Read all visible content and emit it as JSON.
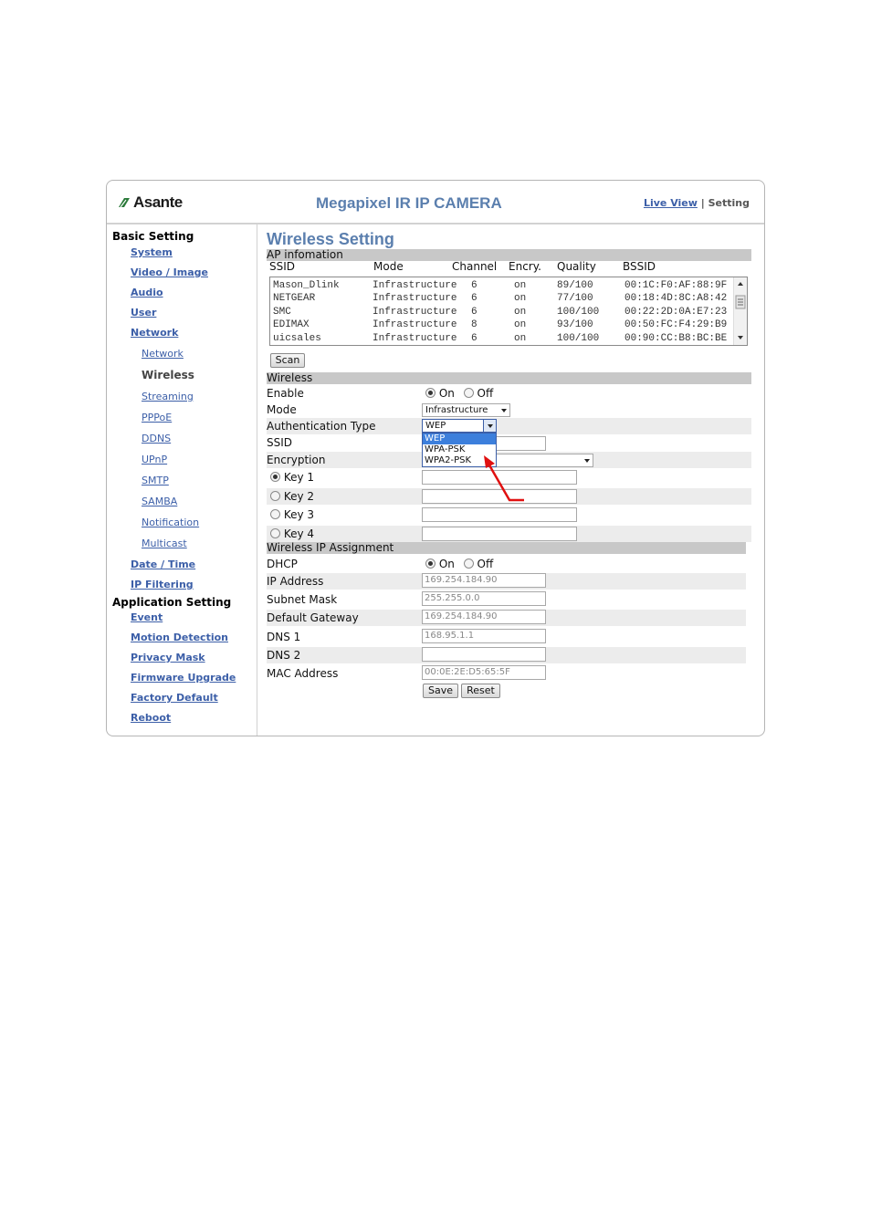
{
  "header": {
    "brand": "Asante",
    "product": "Megapixel IR IP CAMERA",
    "nav_live": "Live View",
    "nav_sep": "|",
    "nav_setting": "Setting"
  },
  "sidebar": {
    "basic_heading": "Basic Setting",
    "app_heading": "Application Setting",
    "basic_items": [
      "System",
      "Video / Image",
      "Audio",
      "User",
      "Network"
    ],
    "network_items": [
      "Network",
      "Wireless",
      "Streaming",
      "PPPoE",
      "DDNS",
      "UPnP",
      "SMTP",
      "SAMBA",
      "Notification",
      "Multicast"
    ],
    "basic_tail": [
      "Date / Time",
      "IP Filtering"
    ],
    "app_items": [
      "Event",
      "Motion Detection",
      "Privacy Mask",
      "Firmware Upgrade",
      "Factory Default",
      "Reboot"
    ]
  },
  "main": {
    "title": "Wireless Setting",
    "ap_section": "AP infomation",
    "ap_columns": [
      "SSID",
      "Mode",
      "Channel",
      "Encry.",
      "Quality",
      "BSSID"
    ],
    "ap_rows": [
      [
        "Mason_Dlink",
        "Infrastructure",
        "6",
        "on",
        "89/100",
        "00:1C:F0:AF:88:9F"
      ],
      [
        "NETGEAR",
        "Infrastructure",
        "6",
        "on",
        "77/100",
        "00:18:4D:8C:A8:42"
      ],
      [
        "SMC",
        "Infrastructure",
        "6",
        "on",
        "100/100",
        "00:22:2D:0A:E7:23"
      ],
      [
        "EDIMAX",
        "Infrastructure",
        "8",
        "on",
        "93/100",
        "00:50:FC:F4:29:B9"
      ],
      [
        "uicsales",
        "Infrastructure",
        "6",
        "on",
        "100/100",
        "00:90:CC:B8:BC:BE"
      ]
    ],
    "scan_button": "Scan",
    "wireless_section": "Wireless",
    "enable_label": "Enable",
    "on_label": "On",
    "off_label": "Off",
    "mode_label": "Mode",
    "mode_value": "Infrastructure",
    "auth_label": "Authentication Type",
    "auth_value": "WEP",
    "auth_options": [
      "WEP",
      "WPA-PSK",
      "WPA2-PSK"
    ],
    "ssid_label": "SSID",
    "encryption_label": "Encryption",
    "keys": [
      "Key 1",
      "Key 2",
      "Key 3",
      "Key 4"
    ],
    "ip_section": "Wireless IP Assignment",
    "dhcp_label": "DHCP",
    "ip_label": "IP Address",
    "ip_value": "169.254.184.90",
    "mask_label": "Subnet Mask",
    "mask_value": "255.255.0.0",
    "gw_label": "Default Gateway",
    "gw_value": "169.254.184.90",
    "dns1_label": "DNS 1",
    "dns1_value": "168.95.1.1",
    "dns2_label": "DNS 2",
    "dns2_value": "",
    "mac_label": "MAC Address",
    "mac_value": "00:0E:2E:D5:65:5F",
    "save_button": "Save",
    "reset_button": "Reset"
  },
  "colors": {
    "accent": "#5b7fae",
    "link": "#3c5fa8",
    "highlight": "#3c7fdc",
    "annotation_arrow": "#e01010"
  }
}
